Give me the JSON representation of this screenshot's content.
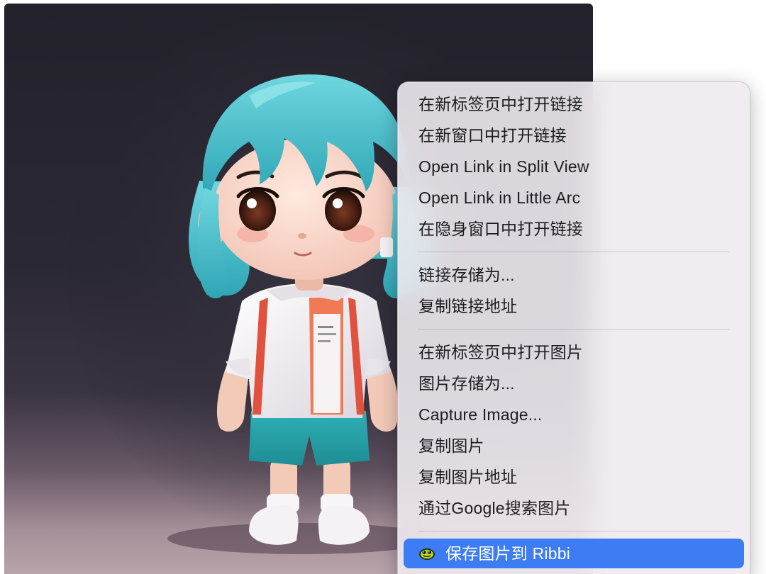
{
  "context_menu": {
    "items": [
      {
        "label": "在新标签页中打开链接"
      },
      {
        "label": "在新窗口中打开链接"
      },
      {
        "label": "Open Link in Split View"
      },
      {
        "label": "Open Link in Little Arc"
      },
      {
        "label": "在隐身窗口中打开链接"
      },
      {
        "label": "链接存储为..."
      },
      {
        "label": "复制链接地址"
      },
      {
        "label": "在新标签页中打开图片"
      },
      {
        "label": "图片存储为..."
      },
      {
        "label": "Capture Image..."
      },
      {
        "label": "复制图片"
      },
      {
        "label": "复制图片地址"
      },
      {
        "label": "通过Google搜索图片"
      },
      {
        "label": "保存图片到 Ribbi",
        "icon": "ribbi-app-icon",
        "selected": true
      }
    ]
  },
  "colors": {
    "highlight": "#3d7cf2",
    "menu_background": "#eeeaf0",
    "image_background": "#23222b"
  }
}
